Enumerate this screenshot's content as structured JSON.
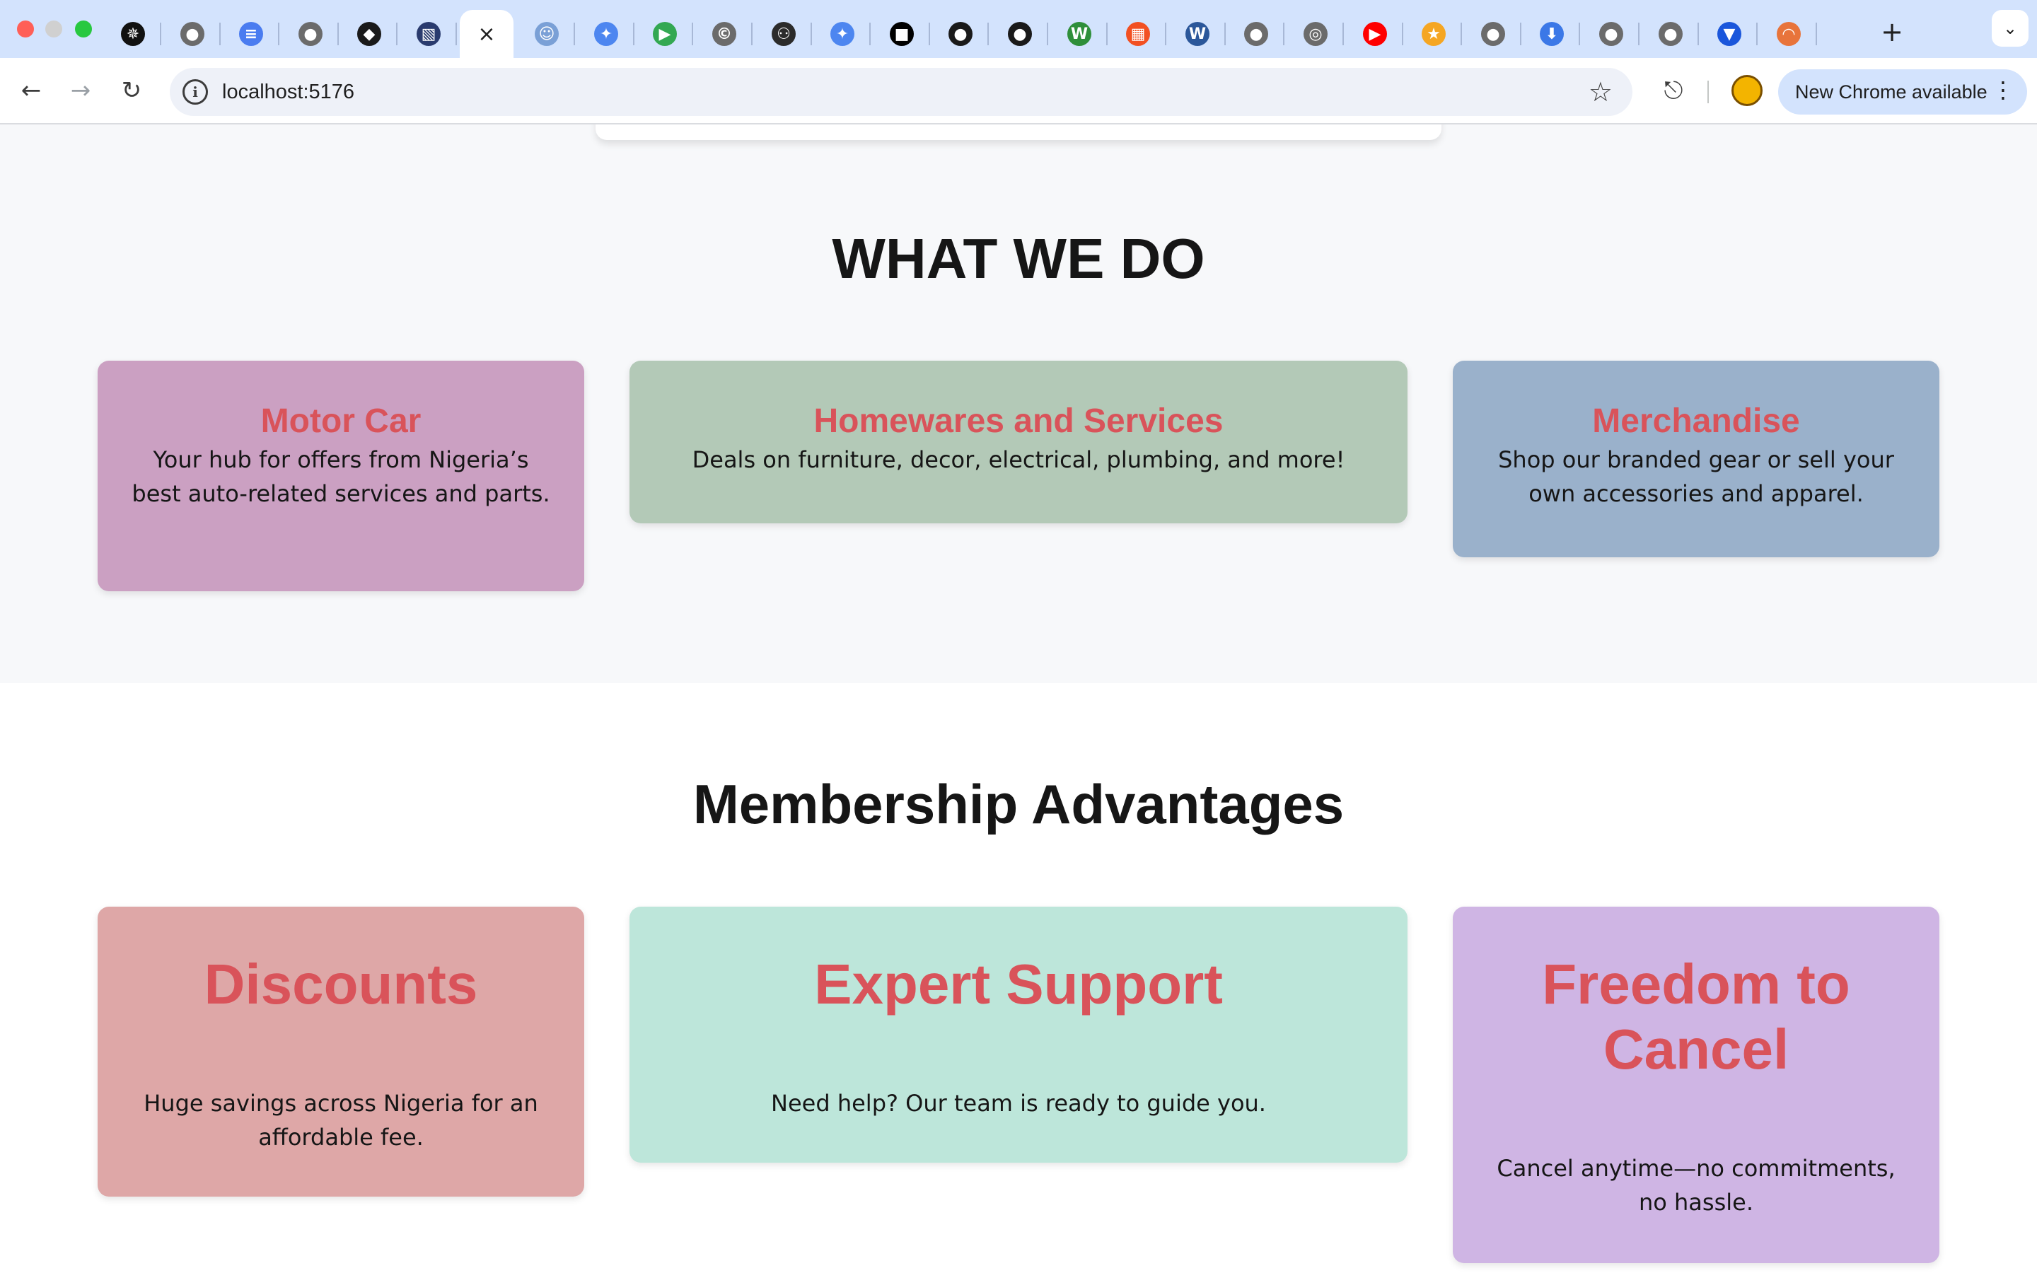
{
  "browser": {
    "tabs": [
      {
        "icon": "openai-icon",
        "color": "#111111",
        "glyph": "✵"
      },
      {
        "icon": "globe-icon",
        "color": "#6b6b6b",
        "glyph": "●"
      },
      {
        "icon": "google-docs-icon",
        "color": "#4a7cf0",
        "glyph": "≡"
      },
      {
        "icon": "globe-icon",
        "color": "#6b6b6b",
        "glyph": "●"
      },
      {
        "icon": "leaf-icon",
        "color": "#1a1a1a",
        "glyph": "◆"
      },
      {
        "icon": "chart-app-icon",
        "color": "#2a3b6e",
        "glyph": "▧"
      },
      {
        "icon": "globe-icon",
        "color": "#6b6b6b",
        "glyph": "●"
      },
      {
        "icon": "robot-icon",
        "color": "#7aa0d6",
        "glyph": "☺"
      },
      {
        "icon": "gemini-icon",
        "color": "#4d86f0",
        "glyph": "✦"
      },
      {
        "icon": "google-meet-icon",
        "color": "#33a852",
        "glyph": "▶"
      },
      {
        "icon": "copyright-icon",
        "color": "#6b6b6b",
        "glyph": "©"
      },
      {
        "icon": "copilot-icon",
        "color": "#2b2b2b",
        "glyph": "⚇"
      },
      {
        "icon": "gemini-icon",
        "color": "#4d86f0",
        "glyph": "✦"
      },
      {
        "icon": "dark-app-icon",
        "color": "#000000",
        "glyph": "■"
      },
      {
        "icon": "github-icon",
        "color": "#1a1a1a",
        "glyph": "●"
      },
      {
        "icon": "github-icon",
        "color": "#1a1a1a",
        "glyph": "●"
      },
      {
        "icon": "w3-icon",
        "color": "#2f8f3a",
        "glyph": "W"
      },
      {
        "icon": "microsoft-icon",
        "color": "#f25022",
        "glyph": "▦"
      },
      {
        "icon": "word-icon",
        "color": "#2b579a",
        "glyph": "W"
      },
      {
        "icon": "globe-icon",
        "color": "#6b6b6b",
        "glyph": "●"
      },
      {
        "icon": "chrome-icon",
        "color": "#6b6b6b",
        "glyph": "◎"
      },
      {
        "icon": "youtube-icon",
        "color": "#ff0000",
        "glyph": "▶"
      },
      {
        "icon": "star-badge-icon",
        "color": "#f5a623",
        "glyph": "★"
      },
      {
        "icon": "globe-icon",
        "color": "#6b6b6b",
        "glyph": "●"
      },
      {
        "icon": "download-icon",
        "color": "#3b78e7",
        "glyph": "⬇"
      },
      {
        "icon": "globe-icon",
        "color": "#6b6b6b",
        "glyph": "●"
      },
      {
        "icon": "globe-icon",
        "color": "#6b6b6b",
        "glyph": "●"
      },
      {
        "icon": "shield-icon",
        "color": "#1a56db",
        "glyph": "▼"
      },
      {
        "icon": "rainbow-icon",
        "color": "#e8743b",
        "glyph": "◠"
      }
    ],
    "active_tab_index": 6,
    "url": "localhost:5176",
    "update_label": "New Chrome available"
  },
  "page": {
    "what_we_do": {
      "heading": "WHAT WE DO",
      "cards": [
        {
          "title": "Motor Car",
          "text": "Your hub for offers from Nigeria’s best auto-related services and parts.",
          "bg": "#cba0c2"
        },
        {
          "title": "Homewares and Services",
          "text": "Deals on furniture, decor, electrical, plumbing, and more!",
          "bg": "#b3c9b7"
        },
        {
          "title": "Merchandise",
          "text": "Shop our branded gear or sell your own accessories and apparel.",
          "bg": "#9ab1cb"
        }
      ]
    },
    "membership": {
      "heading": "Membership Advantages",
      "cards": [
        {
          "title": "Discounts",
          "text": "Huge savings across Nigeria for an affordable fee.",
          "bg": "#dea7a7"
        },
        {
          "title": "Expert Support",
          "text": "Need help? Our team is ready to guide you.",
          "bg": "#bde6da"
        },
        {
          "title": "Freedom to Cancel",
          "text": "Cancel anytime—no commitments, no hassle.",
          "bg": "#cfb5e4"
        }
      ]
    },
    "colors": {
      "card_title": "#d9535a",
      "section_bg": "#f7f8fa",
      "heading": "#161616"
    }
  }
}
